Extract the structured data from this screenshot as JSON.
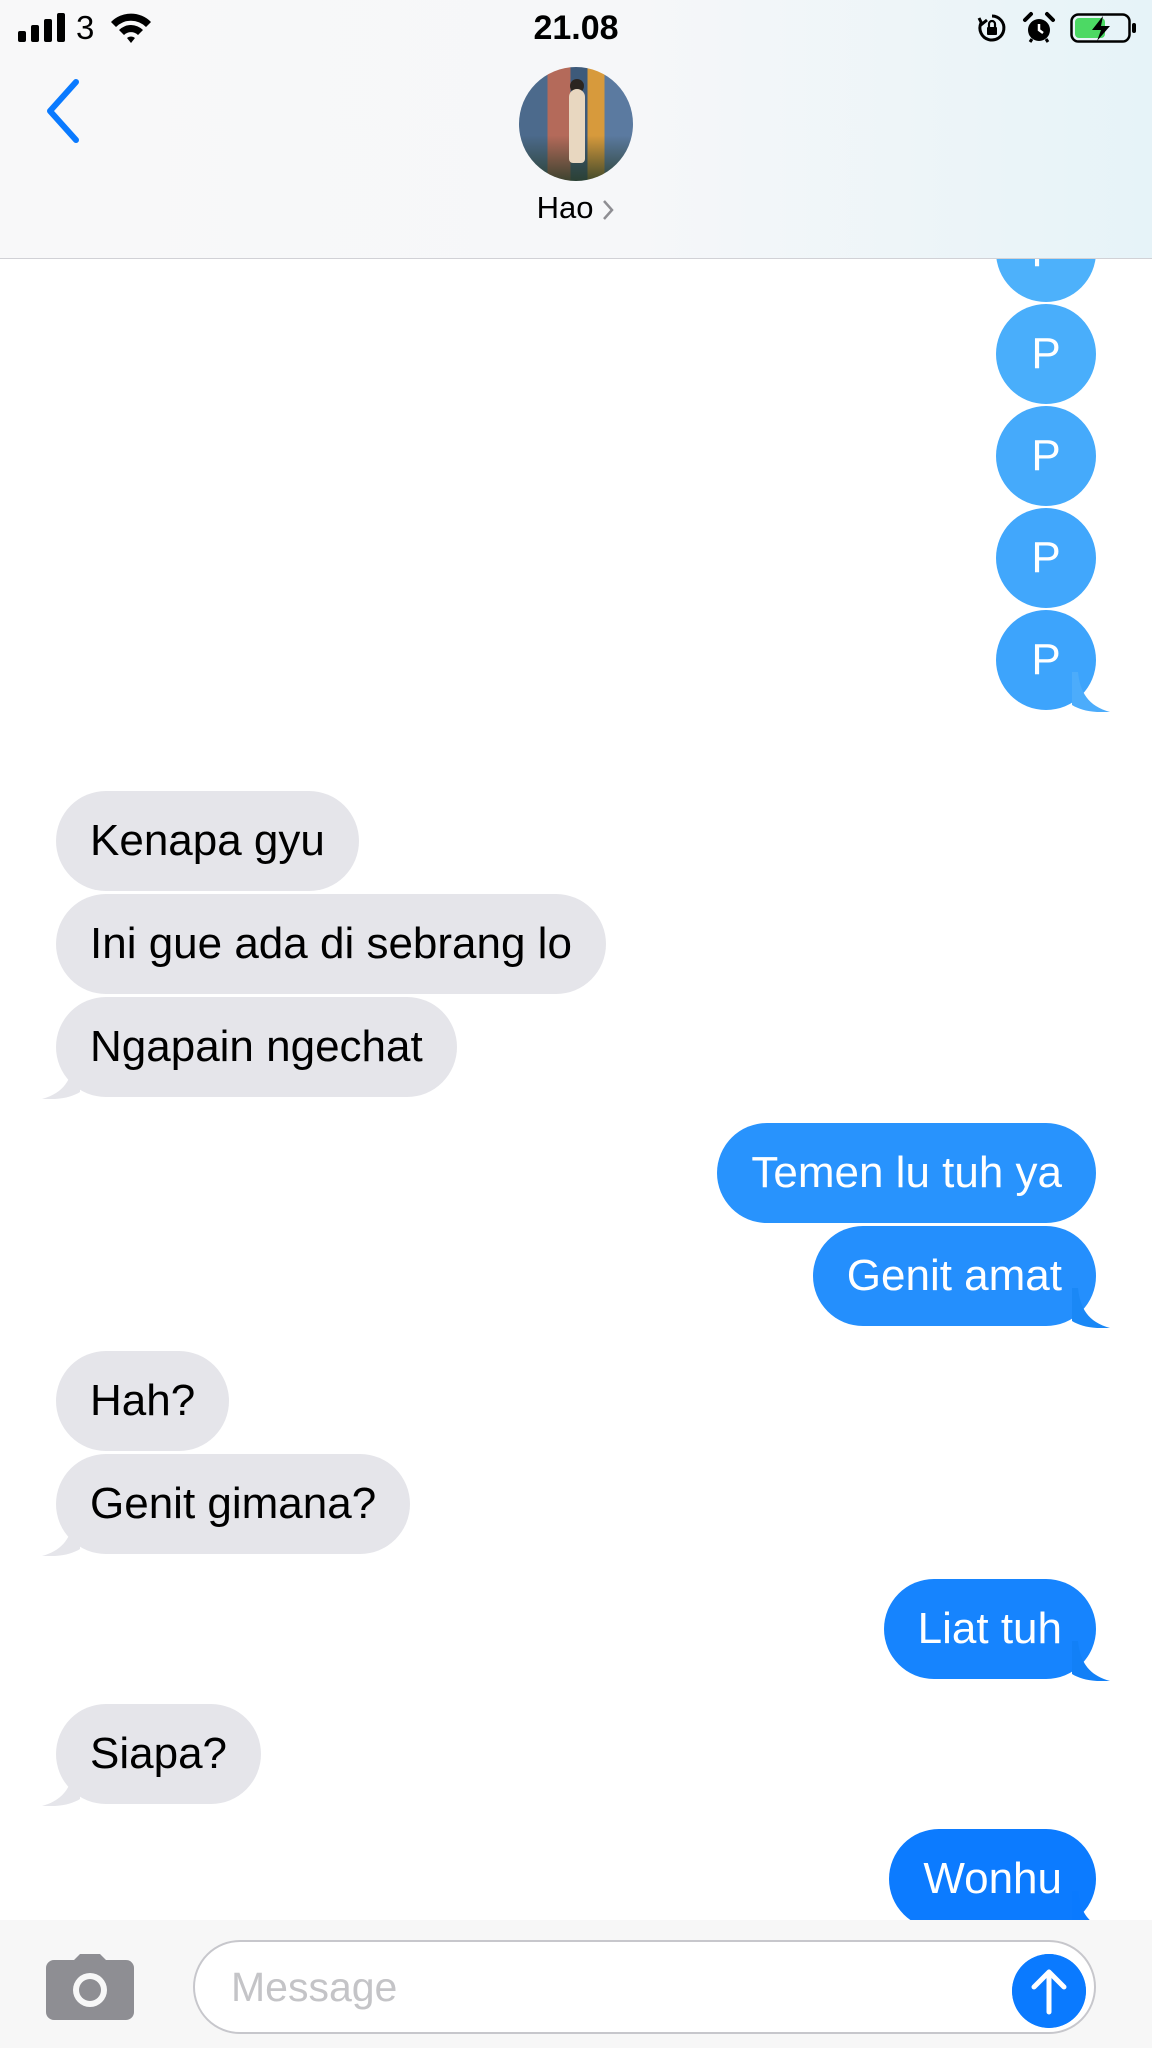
{
  "status_bar": {
    "carrier": "3",
    "time": "21.08"
  },
  "contact": {
    "name": "Hao"
  },
  "messages": [
    {
      "from": "me",
      "text": "P"
    },
    {
      "from": "me",
      "text": "P"
    },
    {
      "from": "me",
      "text": "P"
    },
    {
      "from": "me",
      "text": "P"
    },
    {
      "from": "me",
      "text": "P"
    },
    {
      "from": "them",
      "text": "Kenapa gyu"
    },
    {
      "from": "them",
      "text": "Ini gue ada di sebrang lo"
    },
    {
      "from": "them",
      "text": "Ngapain ngechat"
    },
    {
      "from": "me",
      "text": "Temen lu tuh ya"
    },
    {
      "from": "me",
      "text": "Genit amat"
    },
    {
      "from": "them",
      "text": "Hah?"
    },
    {
      "from": "them",
      "text": "Genit gimana?"
    },
    {
      "from": "me",
      "text": "Liat tuh"
    },
    {
      "from": "them",
      "text": "Siapa?"
    },
    {
      "from": "me",
      "text": "Wonhu"
    }
  ],
  "input": {
    "placeholder": "Message",
    "value": ""
  },
  "colors": {
    "sent_top": "#4db1fb",
    "sent_bottom": "#0a7aff",
    "received": "#e5e5ea",
    "accent": "#0a7aff"
  },
  "icons": {
    "back": "chevron-left-icon",
    "camera": "camera-icon",
    "send": "arrow-up-icon",
    "orientation_lock": "orientation-lock-icon",
    "alarm": "alarm-icon",
    "battery": "battery-charging-icon"
  }
}
